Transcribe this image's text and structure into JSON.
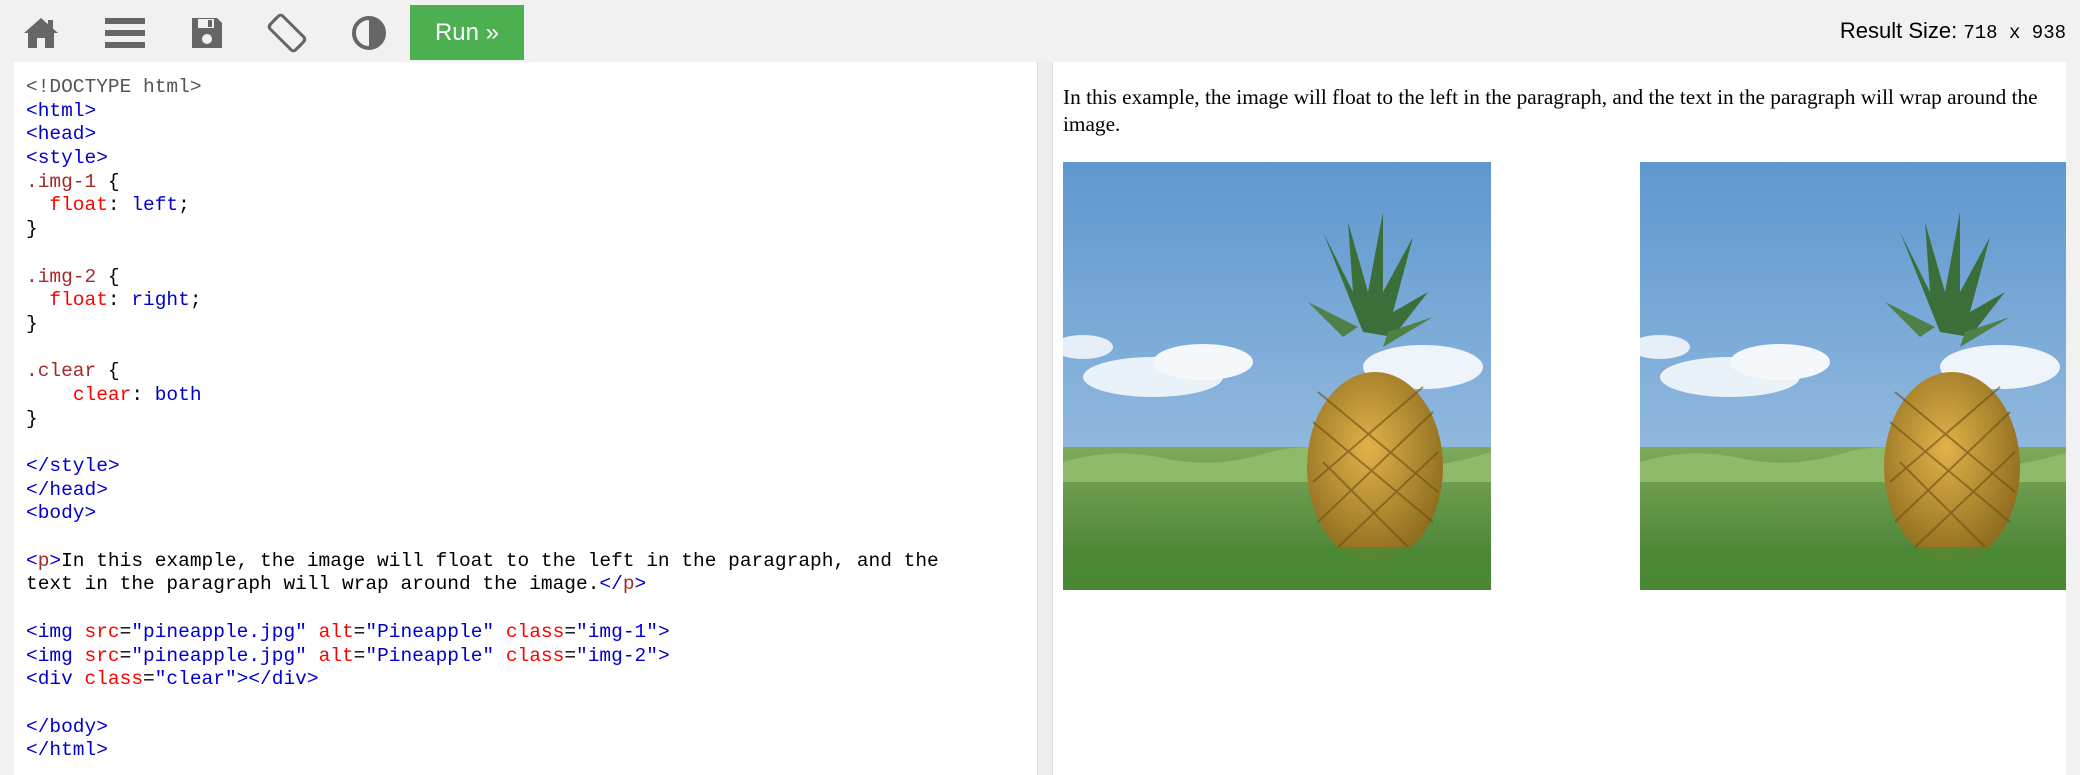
{
  "toolbar": {
    "icons": [
      "home-icon",
      "menu-icon",
      "save-icon",
      "rotate-icon",
      "contrast-icon"
    ],
    "run_label": "Run »",
    "result_size_label": "Result Size:",
    "result_size_value": "718 x 938"
  },
  "editor": {
    "lines": [
      [
        {
          "t": "<!DOCTYPE html>",
          "c": "gray"
        }
      ],
      [
        {
          "t": "<html>",
          "c": "blue"
        }
      ],
      [
        {
          "t": "<head>",
          "c": "blue"
        }
      ],
      [
        {
          "t": "<style>",
          "c": "blue"
        }
      ],
      [
        {
          "t": ".img-1",
          "c": "red"
        },
        {
          "t": " {",
          "c": "blk"
        }
      ],
      [
        {
          "t": "  ",
          "c": "blk"
        },
        {
          "t": "float",
          "c": "attr"
        },
        {
          "t": ": ",
          "c": "blk"
        },
        {
          "t": "left",
          "c": "blue"
        },
        {
          "t": ";",
          "c": "blk"
        }
      ],
      [
        {
          "t": "}",
          "c": "blk"
        }
      ],
      [
        {
          "t": "",
          "c": "blk"
        }
      ],
      [
        {
          "t": ".img-2",
          "c": "red"
        },
        {
          "t": " {",
          "c": "blk"
        }
      ],
      [
        {
          "t": "  ",
          "c": "blk"
        },
        {
          "t": "float",
          "c": "attr"
        },
        {
          "t": ": ",
          "c": "blk"
        },
        {
          "t": "right",
          "c": "blue"
        },
        {
          "t": ";",
          "c": "blk"
        }
      ],
      [
        {
          "t": "}",
          "c": "blk"
        }
      ],
      [
        {
          "t": "",
          "c": "blk"
        }
      ],
      [
        {
          "t": ".clear",
          "c": "red"
        },
        {
          "t": " {",
          "c": "blk"
        }
      ],
      [
        {
          "t": "    ",
          "c": "blk"
        },
        {
          "t": "clear",
          "c": "attr"
        },
        {
          "t": ": ",
          "c": "blk"
        },
        {
          "t": "both",
          "c": "blue"
        }
      ],
      [
        {
          "t": "}",
          "c": "blk"
        }
      ],
      [
        {
          "t": "",
          "c": "blk"
        }
      ],
      [
        {
          "t": "</style>",
          "c": "blue"
        }
      ],
      [
        {
          "t": "</head>",
          "c": "blue"
        }
      ],
      [
        {
          "t": "<body>",
          "c": "blue"
        }
      ],
      [
        {
          "t": "",
          "c": "blk"
        }
      ],
      [
        {
          "t": "<",
          "c": "blue"
        },
        {
          "t": "p",
          "c": "red"
        },
        {
          "t": ">",
          "c": "blue"
        },
        {
          "t": "In this example, the image will float to the left in the paragraph, and the",
          "c": "blk"
        }
      ],
      [
        {
          "t": "text in the paragraph will wrap around the image.",
          "c": "blk"
        },
        {
          "t": "</",
          "c": "blue"
        },
        {
          "t": "p",
          "c": "red"
        },
        {
          "t": ">",
          "c": "blue"
        }
      ],
      [
        {
          "t": "",
          "c": "blk"
        }
      ],
      [
        {
          "t": "<img ",
          "c": "blue"
        },
        {
          "t": "src",
          "c": "attr"
        },
        {
          "t": "=",
          "c": "blk"
        },
        {
          "t": "\"pineapple.jpg\"",
          "c": "blue"
        },
        {
          "t": " ",
          "c": "blk"
        },
        {
          "t": "alt",
          "c": "attr"
        },
        {
          "t": "=",
          "c": "blk"
        },
        {
          "t": "\"Pineapple\"",
          "c": "blue"
        },
        {
          "t": " ",
          "c": "blk"
        },
        {
          "t": "class",
          "c": "attr"
        },
        {
          "t": "=",
          "c": "blk"
        },
        {
          "t": "\"img-1\"",
          "c": "blue"
        },
        {
          "t": ">",
          "c": "blue"
        }
      ],
      [
        {
          "t": "<img ",
          "c": "blue"
        },
        {
          "t": "src",
          "c": "attr"
        },
        {
          "t": "=",
          "c": "blk"
        },
        {
          "t": "\"pineapple.jpg\"",
          "c": "blue"
        },
        {
          "t": " ",
          "c": "blk"
        },
        {
          "t": "alt",
          "c": "attr"
        },
        {
          "t": "=",
          "c": "blk"
        },
        {
          "t": "\"Pineapple\"",
          "c": "blue"
        },
        {
          "t": " ",
          "c": "blk"
        },
        {
          "t": "class",
          "c": "attr"
        },
        {
          "t": "=",
          "c": "blk"
        },
        {
          "t": "\"img-2\"",
          "c": "blue"
        },
        {
          "t": ">",
          "c": "blue"
        }
      ],
      [
        {
          "t": "<div ",
          "c": "blue"
        },
        {
          "t": "class",
          "c": "attr"
        },
        {
          "t": "=",
          "c": "blk"
        },
        {
          "t": "\"clear\"",
          "c": "blue"
        },
        {
          "t": "></div>",
          "c": "blue"
        }
      ],
      [
        {
          "t": "",
          "c": "blk"
        }
      ],
      [
        {
          "t": "</body>",
          "c": "blue"
        }
      ],
      [
        {
          "t": "</html>",
          "c": "blue"
        }
      ]
    ]
  },
  "result": {
    "paragraph": "In this example, the image will float to the left in the paragraph, and the text in the paragraph will wrap around the image."
  },
  "colors": {
    "run_green": "#4caf50",
    "toolbar_icon": "#666666",
    "tag_blue": "#0000cd",
    "selector_brown": "#a52a2a",
    "attr_red": "#ff0000"
  }
}
